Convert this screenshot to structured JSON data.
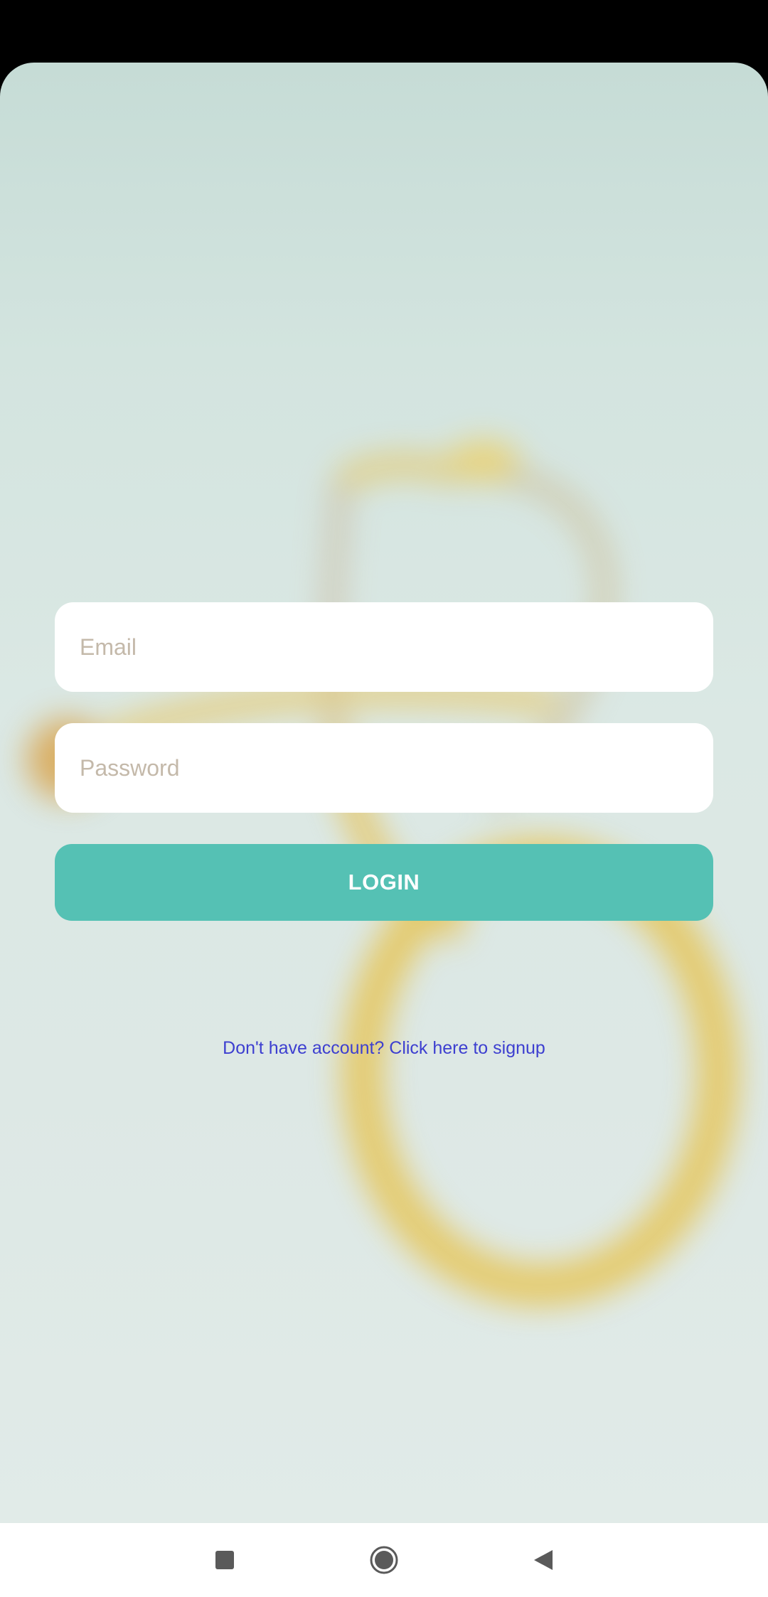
{
  "login_form": {
    "email_placeholder": "Email",
    "password_placeholder": "Password",
    "login_label": "LOGIN",
    "signup_link": "Don't have account? Click here to signup"
  },
  "system_nav": {
    "recents_icon": "square-recents-icon",
    "home_icon": "circle-home-icon",
    "back_icon": "triangle-back-icon"
  },
  "colors": {
    "accent": "#55c1b4",
    "link": "#3d3fd0",
    "placeholder": "#c4b9aa",
    "background": "#d8e6e2"
  }
}
